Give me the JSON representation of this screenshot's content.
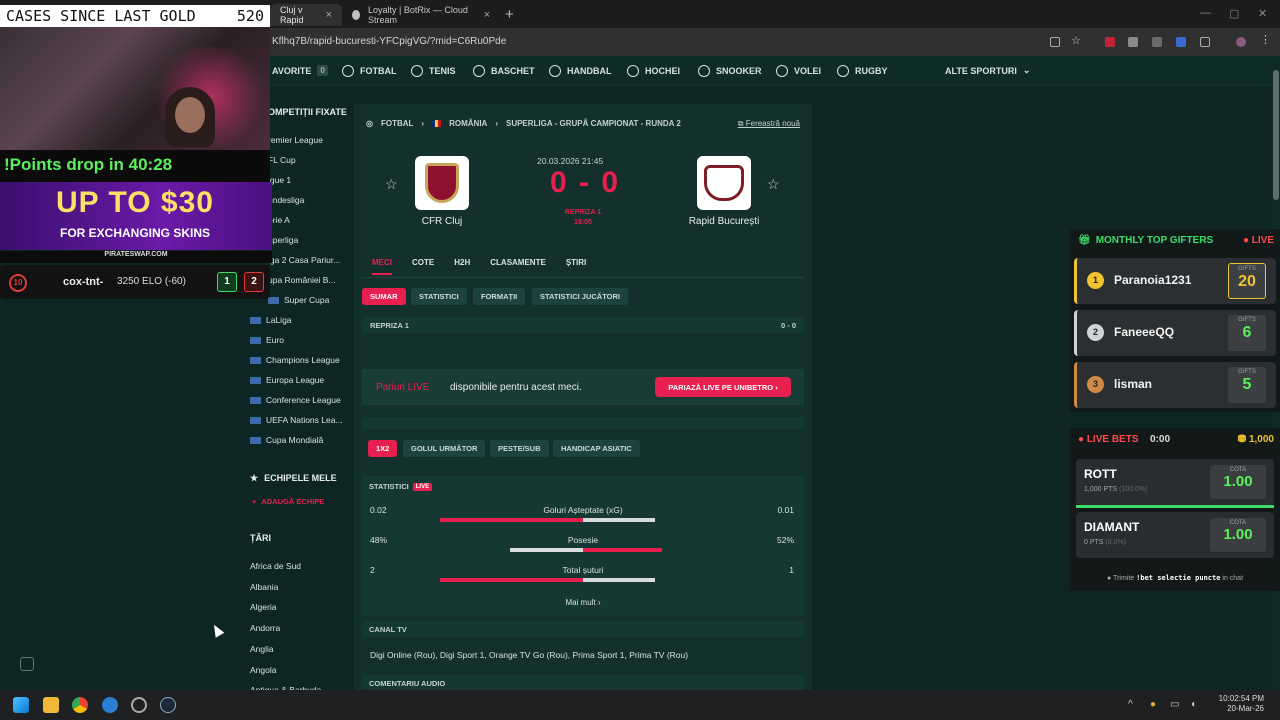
{
  "browser": {
    "tabs": [
      {
        "label": "Cluj v Rapid"
      },
      {
        "label": "Loyalty | BotRix — Cloud Stream"
      }
    ],
    "url": "Kflhq7B/rapid-bucuresti-YFCpigVG/?mid=C6Ru0Pde"
  },
  "site_nav": {
    "favorite_label": "AVORITE",
    "favorite_count": "0",
    "sports": [
      "FOTBAL",
      "TENIS",
      "BASCHET",
      "HANDBAL",
      "HOCHEI",
      "SNOOKER",
      "VOLEI",
      "RUGBY"
    ],
    "other_sports": "ALTE SPORTURI"
  },
  "sidebar": {
    "pinned_title": "OMPETIȚII FIXATE",
    "pinned": [
      "remier League",
      "FL Cup",
      "igue 1",
      "undesliga",
      "erie A",
      "uperliga",
      "iga 2 Casa Pariur...",
      "upa României B...",
      "Super Cupa",
      "LaLiga",
      "Euro",
      "Champions League",
      "Europa League",
      "Conference League",
      "UEFA Nations Lea...",
      "Cupa Mondială"
    ],
    "teams_title": "ECHIPELE MELE",
    "add_team": "ADAUGĂ ECHIPE",
    "countries_title": "ȚĂRI",
    "countries": [
      "Africa de Sud",
      "Albania",
      "Algeria",
      "Andorra",
      "Anglia",
      "Angola",
      "Antigua & Barbuda"
    ]
  },
  "match": {
    "breadcrumb": [
      "FOTBAL",
      "ROMÂNIA",
      "SUPERLIGA - GRUPĂ CAMPIONAT - RUNDA 2"
    ],
    "new_window": "Fereastră nouă",
    "datetime": "20.03.2026 21:45",
    "score": "0 - 0",
    "period": "REPRIZA 1",
    "minute": "16:05",
    "home": "CFR Cluj",
    "away": "Rapid București",
    "tabs": [
      "MECI",
      "COTE",
      "H2H",
      "CLASAMENTE",
      "ȘTIRI"
    ],
    "subtabs": [
      "SUMAR",
      "STATISTICI",
      "FORMAȚII",
      "STATISTICI JUCĂTORI"
    ],
    "half_label": "REPRIZA 1",
    "half_score": "0 - 0",
    "live_title": "Pariuri LIVE",
    "live_text": "disponibile pentru acest meci.",
    "live_button": "PARIAZĂ LIVE PE UNIBETRO",
    "odds_tabs": [
      "1X2",
      "GOLUL URMĂTOR",
      "PESTE/SUB",
      "HANDICAP ASIATIC"
    ],
    "stats_title": "STATISTICI",
    "stats_live": "LIVE",
    "stats": [
      {
        "name": "Goluri Așteptate (xG)",
        "home": "0.02",
        "away": "0.01",
        "home_frac": 1.0,
        "away_frac": 0.5
      },
      {
        "name": "Posesie",
        "home": "48%",
        "away": "52%",
        "home_frac": 0.48,
        "away_frac": 0.52
      },
      {
        "name": "Total șuturi",
        "home": "2",
        "away": "1",
        "home_frac": 1.0,
        "away_frac": 0.5
      }
    ],
    "more": "Mai mult",
    "tv_title": "CANAL TV",
    "tv_channels": "Digi Online (Rou),  Digi Sport 1,  Orange TV Go (Rou),  Prima Sport 1,  Prima TV (Rou)",
    "audio_title": "COMENTARIU AUDIO"
  },
  "overlay": {
    "top_left": "CASES SINCE LAST GOLD",
    "top_right": "520",
    "points": "!Points drop in 40:28",
    "promo_big": "UP TO $30",
    "promo_small": "FOR EXCHANGING SKINS",
    "promo_site": "PIRATESWAP.COM",
    "elo_level": "10",
    "elo_name": "cox-tnt-",
    "elo_value": "3250 ELO (-60)",
    "elo_win": "1",
    "elo_loss": "2"
  },
  "gifters": {
    "title": "MONTHLY TOP GIFTERS",
    "live": "LIVE",
    "gifts_label": "GIFTS",
    "rows": [
      {
        "rank": "1",
        "name": "Paranoia1231",
        "gifts": "20",
        "color": "#f2c230"
      },
      {
        "rank": "2",
        "name": "FaneeeQQ",
        "gifts": "6",
        "color": "#cfd3d6"
      },
      {
        "rank": "3",
        "name": "lisman",
        "gifts": "5",
        "color": "#d08a48"
      }
    ]
  },
  "bets": {
    "title": "LIVE BETS",
    "timer": "0:00",
    "pot": "1,000",
    "cota_label": "COTA",
    "options": [
      {
        "name": "ROTT",
        "pts": "1,000 PTS",
        "pct": "(100.0%)",
        "cota": "1.00"
      },
      {
        "name": "DIAMANT",
        "pts": "0 PTS",
        "pct": "(0.0%)",
        "cota": "1.00"
      }
    ],
    "foot_pre": "Trimite",
    "foot_cmd": "!bet selectie puncte",
    "foot_post": "in chat"
  },
  "taskbar": {
    "time": "10:02:54 PM",
    "date": "20-Mar-26"
  },
  "colors": {
    "accent": "#e8204f",
    "bg": "#0d2623",
    "card": "#13302c"
  }
}
